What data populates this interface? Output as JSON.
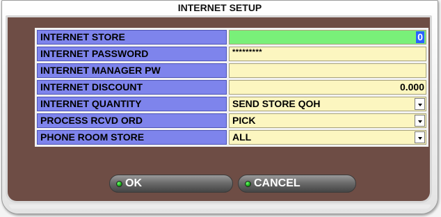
{
  "dialog": {
    "title": "INTERNET SETUP"
  },
  "fields": [
    {
      "label": "INTERNET STORE",
      "value": "0"
    },
    {
      "label": "INTERNET PASSWORD",
      "value": "*********"
    },
    {
      "label": "INTERNET MANAGER PW",
      "value": ""
    },
    {
      "label": "INTERNET DISCOUNT",
      "value": "0.000"
    },
    {
      "label": "INTERNET QUANTITY",
      "value": "SEND STORE QOH"
    },
    {
      "label": "PROCESS RCVD ORD",
      "value": "PICK"
    },
    {
      "label": "PHONE ROOM STORE",
      "value": "ALL"
    }
  ],
  "buttons": {
    "ok_label": "OK",
    "cancel_label": "CANCEL"
  },
  "colors": {
    "frame": "#6e4d45",
    "label_bg": "#7e84ec",
    "value_bg": "#fcf6c0",
    "active_bg": "#79f079",
    "selection": "#2a62ff"
  }
}
